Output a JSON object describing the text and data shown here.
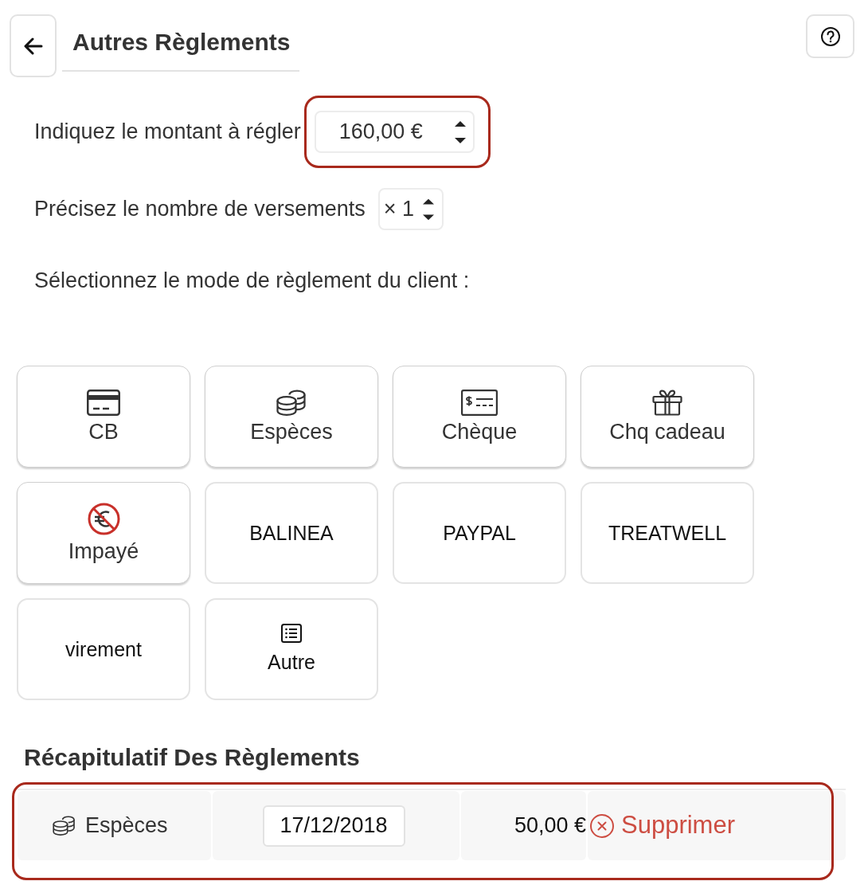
{
  "header": {
    "title": "Autres Règlements"
  },
  "amount": {
    "label": "Indiquez le montant à régler",
    "value": "160,00 €",
    "highlighted": true
  },
  "installments": {
    "label": "Précisez le nombre de versements",
    "value": "× 1"
  },
  "modes": {
    "prompt": "Sélectionnez le mode de règlement du client :",
    "items": [
      {
        "label": "CB",
        "kind": "card",
        "raised": true
      },
      {
        "label": "Espèces",
        "kind": "cash",
        "raised": true
      },
      {
        "label": "Chèque",
        "kind": "cheque",
        "raised": true
      },
      {
        "label": "Chq cadeau",
        "kind": "gift_cheque",
        "raised": true
      },
      {
        "label": "Impayé",
        "kind": "unpaid",
        "raised": true
      },
      {
        "label": "BALINEA",
        "kind": "custom",
        "raised": false
      },
      {
        "label": "PAYPAL",
        "kind": "custom",
        "raised": false
      },
      {
        "label": "TREATWELL",
        "kind": "custom",
        "raised": false
      },
      {
        "label": "virement",
        "kind": "custom",
        "raised": false
      },
      {
        "label": "Autre",
        "kind": "other",
        "raised": false
      }
    ]
  },
  "summary": {
    "title": "Récapitulatif Des Règlements",
    "highlighted": true,
    "rows": [
      {
        "kind": "cash",
        "mode": "Espèces",
        "date": "17/12/2018",
        "amount": "50,00 €",
        "action": "Supprimer"
      }
    ]
  }
}
